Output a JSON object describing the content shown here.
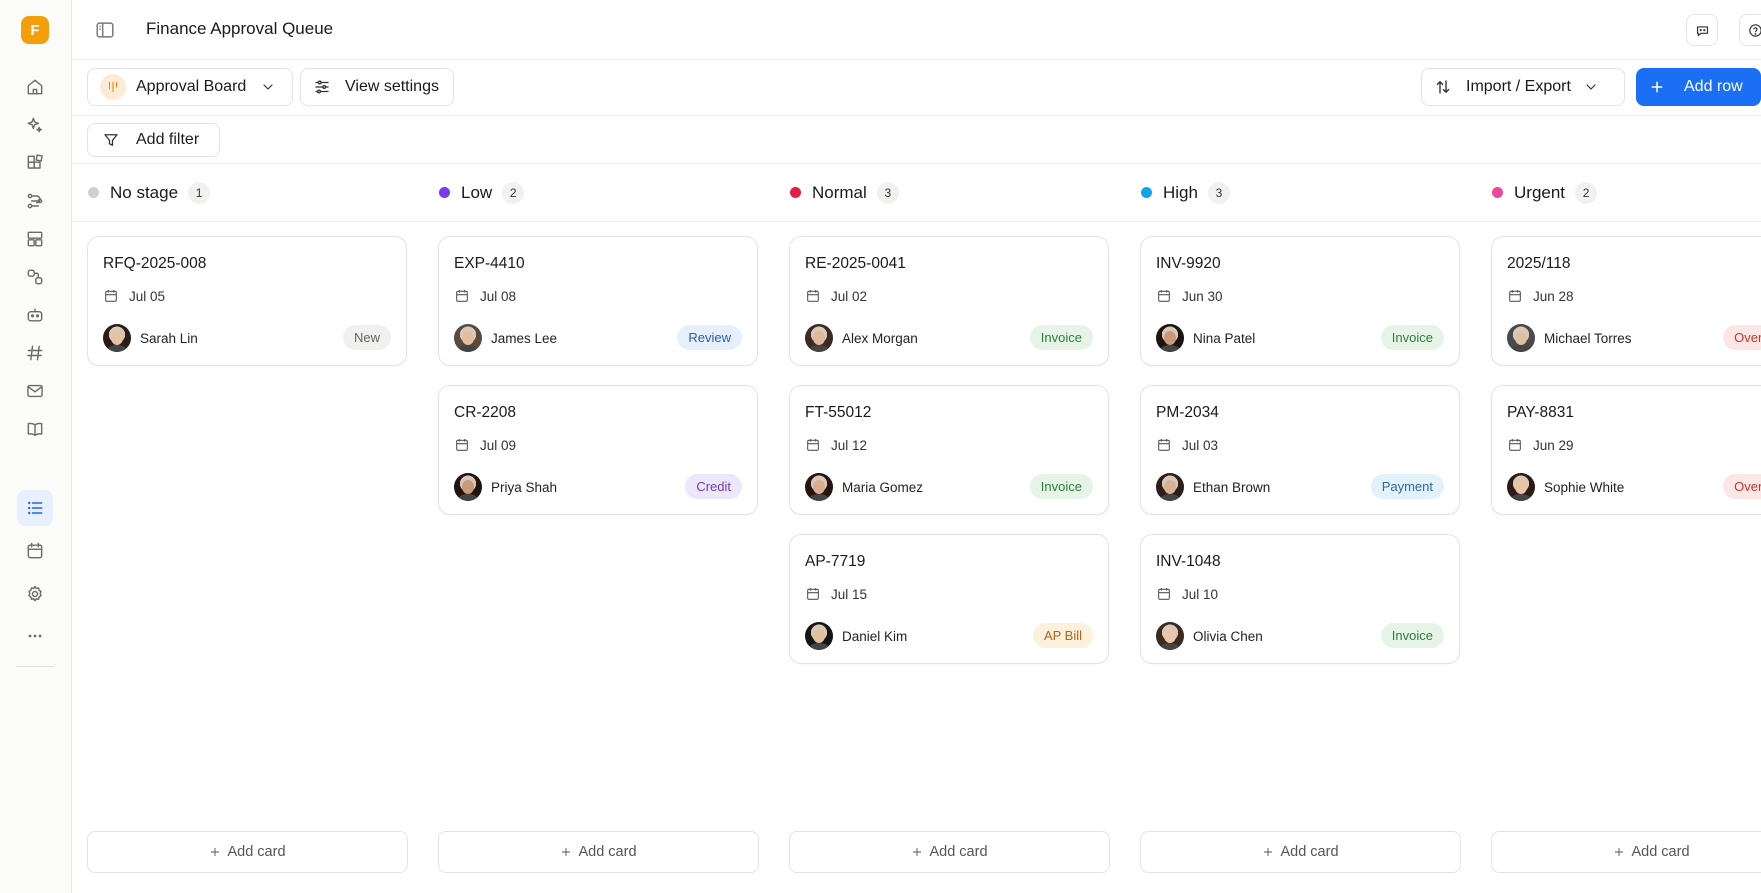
{
  "app": {
    "brand_letter": "F",
    "title": "Finance Approval Queue"
  },
  "toolbar": {
    "board_label": "Approval Board",
    "view_settings_label": "View settings",
    "import_export_label": "Import / Export",
    "add_row_label": "Add row"
  },
  "filters": {
    "add_filter_label": "Add filter"
  },
  "sidebar": {
    "items": [
      {
        "icon": "home-icon"
      },
      {
        "icon": "sparkles-icon"
      },
      {
        "icon": "apps-icon"
      },
      {
        "icon": "workflow-icon"
      },
      {
        "icon": "layout-icon"
      },
      {
        "icon": "integrations-icon"
      },
      {
        "icon": "bot-icon"
      },
      {
        "icon": "hash-icon"
      },
      {
        "icon": "mail-icon"
      },
      {
        "icon": "book-icon"
      },
      {
        "icon": "list-icon",
        "active": true
      },
      {
        "icon": "calendar-icon"
      },
      {
        "icon": "settings-icon"
      },
      {
        "icon": "more-icon"
      }
    ]
  },
  "colors": {
    "accent": "#1a6ff5",
    "brand": "#f59e0b"
  },
  "columns": [
    {
      "name": "No stage",
      "count": "1",
      "dot_color": "#cfcfcf",
      "add_card_label": "Add card",
      "cards": [
        {
          "title": "RFQ-2025-008",
          "date": "Jul 05",
          "person": "Sarah Lin",
          "tag": "New",
          "tag_bg": "#f0f0ee",
          "tag_fg": "#666666",
          "hair": "#2b1d16",
          "skin": "#e6c2a5"
        }
      ]
    },
    {
      "name": "Low",
      "count": "2",
      "dot_color": "#7c3aed",
      "add_card_label": "Add card",
      "cards": [
        {
          "title": "EXP-4410",
          "date": "Jul 08",
          "person": "James Lee",
          "tag": "Review",
          "tag_bg": "#e6f0fd",
          "tag_fg": "#2b5fa8",
          "hair": "#5a4a3e",
          "skin": "#e3bfa0"
        },
        {
          "title": "CR-2208",
          "date": "Jul 09",
          "person": "Priya Shah",
          "tag": "Credit",
          "tag_bg": "#eee6fb",
          "tag_fg": "#6b3fb5",
          "hair": "#1f1410",
          "skin": "#c99a7a"
        }
      ]
    },
    {
      "name": "Normal",
      "count": "3",
      "dot_color": "#e11d48",
      "add_card_label": "Add card",
      "cards": [
        {
          "title": "RE-2025-0041",
          "date": "Jul 02",
          "person": "Alex Morgan",
          "tag": "Invoice",
          "tag_bg": "#e5f4e7",
          "tag_fg": "#2f7d3a",
          "hair": "#3a2c24",
          "skin": "#e0b99a"
        },
        {
          "title": "FT-55012",
          "date": "Jul 12",
          "person": "Maria Gomez",
          "tag": "Invoice",
          "tag_bg": "#e5f4e7",
          "tag_fg": "#2f7d3a",
          "hair": "#24160f",
          "skin": "#d9ad8e"
        },
        {
          "title": "AP-7719",
          "date": "Jul 15",
          "person": "Daniel Kim",
          "tag": "AP Bill",
          "tag_bg": "#fdf0dc",
          "tag_fg": "#a8661a",
          "hair": "#151515",
          "skin": "#e2bf9e"
        }
      ]
    },
    {
      "name": "High",
      "count": "3",
      "dot_color": "#0ea5e9",
      "add_card_label": "Add card",
      "cards": [
        {
          "title": "INV-9920",
          "date": "Jun 30",
          "person": "Nina Patel",
          "tag": "Invoice",
          "tag_bg": "#e5f4e7",
          "tag_fg": "#2f7d3a",
          "hair": "#1c1410",
          "skin": "#c9987a"
        },
        {
          "title": "PM-2034",
          "date": "Jul 03",
          "person": "Ethan Brown",
          "tag": "Payment",
          "tag_bg": "#e3f1fb",
          "tag_fg": "#2c6aa0",
          "hair": "#2a1f19",
          "skin": "#d9b293"
        },
        {
          "title": "INV-1048",
          "date": "Jul 10",
          "person": "Olivia Chen",
          "tag": "Invoice",
          "tag_bg": "#e5f4e7",
          "tag_fg": "#2f7d3a",
          "hair": "#3b2a20",
          "skin": "#e8c6aa"
        }
      ]
    },
    {
      "name": "Urgent",
      "count": "2",
      "dot_color": "#ec4899",
      "add_card_label": "Add card",
      "cards": [
        {
          "title": "2025/118",
          "date": "Jun 28",
          "person": "Michael Torres",
          "tag": "Overdue",
          "tag_bg": "#fce6e6",
          "tag_fg": "#c0392b",
          "hair": "#4a4a4a",
          "skin": "#e0bfa2"
        },
        {
          "title": "PAY-8831",
          "date": "Jun 29",
          "person": "Sophie White",
          "tag": "Overdue",
          "tag_bg": "#fce6e6",
          "tag_fg": "#c0392b",
          "hair": "#2a1c15",
          "skin": "#e7c4a6"
        }
      ]
    }
  ]
}
